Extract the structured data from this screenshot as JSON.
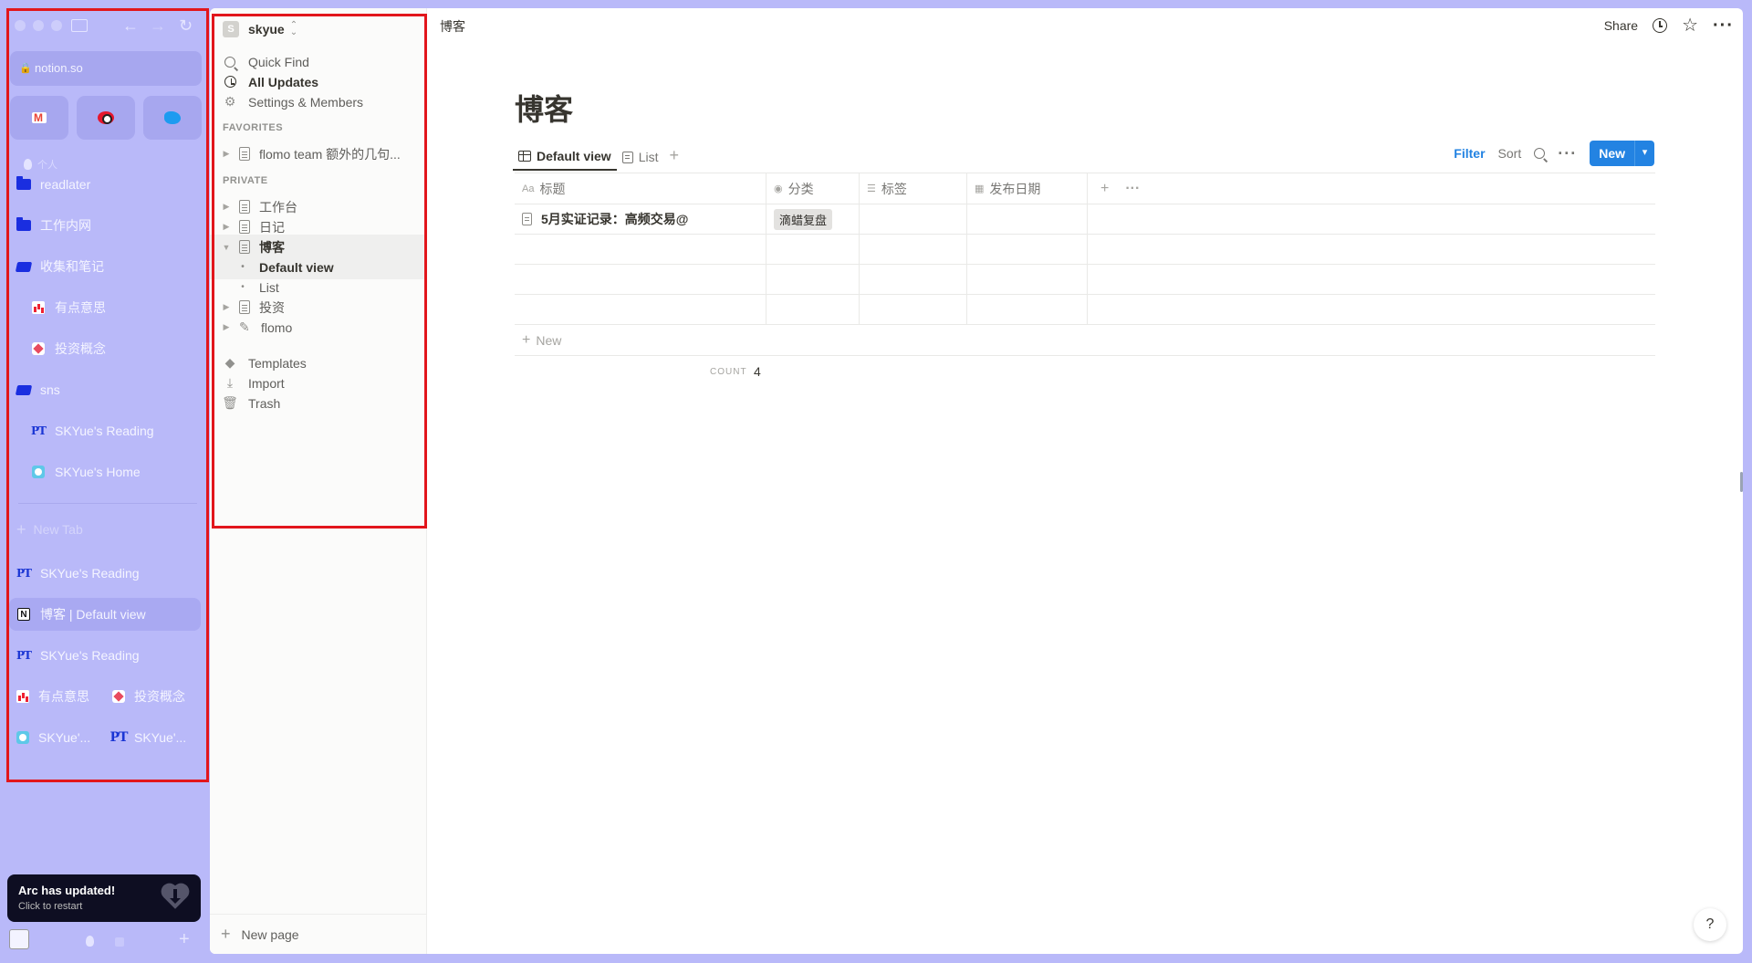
{
  "arc": {
    "url": "notion.so",
    "section_label": "个人",
    "items": [
      {
        "label": "readlater",
        "icon": "folder-icon"
      },
      {
        "label": "工作内网",
        "icon": "folder-icon"
      },
      {
        "label": "收集和笔记",
        "icon": "folder-open-icon"
      },
      {
        "label": "有点意思",
        "icon": "chart-icon"
      },
      {
        "label": "投资概念",
        "icon": "heart-icon"
      },
      {
        "label": "sns",
        "icon": "folder-open-icon"
      },
      {
        "label": "SKYue's Reading",
        "icon": "pt-icon"
      },
      {
        "label": "SKYue's Home",
        "icon": "sky-icon"
      }
    ],
    "new_tab": "New Tab",
    "tabs": [
      {
        "label": "SKYue's Reading",
        "icon": "pt-icon"
      },
      {
        "label": "博客 | Default view",
        "icon": "notion-icon"
      },
      {
        "label": "SKYue's Reading",
        "icon": "pt-icon"
      }
    ],
    "split1": {
      "left": "有点意思",
      "right": "投资概念"
    },
    "split2": {
      "left": "SKYue'...",
      "right": "SKYue'..."
    },
    "toast": {
      "title": "Arc has updated!",
      "subtitle": "Click to restart"
    }
  },
  "notion": {
    "workspace": {
      "avatar": "S",
      "name": "skyue"
    },
    "top_items": [
      {
        "label": "Quick Find",
        "icon": "search-icon"
      },
      {
        "label": "All Updates",
        "icon": "clock-icon"
      },
      {
        "label": "Settings & Members",
        "icon": "gear-icon"
      }
    ],
    "favorites_label": "FAVORITES",
    "favorites": [
      "flomo team 额外的几句..."
    ],
    "private_label": "PRIVATE",
    "private": [
      "工作台",
      "日记",
      "博客",
      "Default view",
      "List",
      "投资",
      "flomo"
    ],
    "bottom_items": [
      {
        "label": "Templates",
        "icon": "templates-icon"
      },
      {
        "label": "Import",
        "icon": "import-icon"
      },
      {
        "label": "Trash",
        "icon": "trash-icon"
      }
    ],
    "new_page": "New page"
  },
  "topbar": {
    "breadcrumb": "博客",
    "share": "Share"
  },
  "page": {
    "title": "博客",
    "views": [
      "Default view",
      "List"
    ],
    "toolbar": {
      "filter": "Filter",
      "sort": "Sort",
      "new": "New"
    },
    "columns": [
      "标题",
      "分类",
      "标签",
      "发布日期"
    ],
    "rows": [
      {
        "title": "5月实证记录：高频交易@",
        "category": "滴蜡复盘",
        "tags": "",
        "date": ""
      },
      {
        "title": "",
        "category": "",
        "tags": "",
        "date": ""
      },
      {
        "title": "",
        "category": "",
        "tags": "",
        "date": ""
      },
      {
        "title": "",
        "category": "",
        "tags": "",
        "date": ""
      }
    ],
    "new_row": "New",
    "count_label": "COUNT",
    "count_value": "4",
    "help": "?"
  },
  "colors": {
    "arc_bg": "#b9b9f9",
    "accent_blue": "#2383e2",
    "highlight_box": "#e2161c"
  }
}
